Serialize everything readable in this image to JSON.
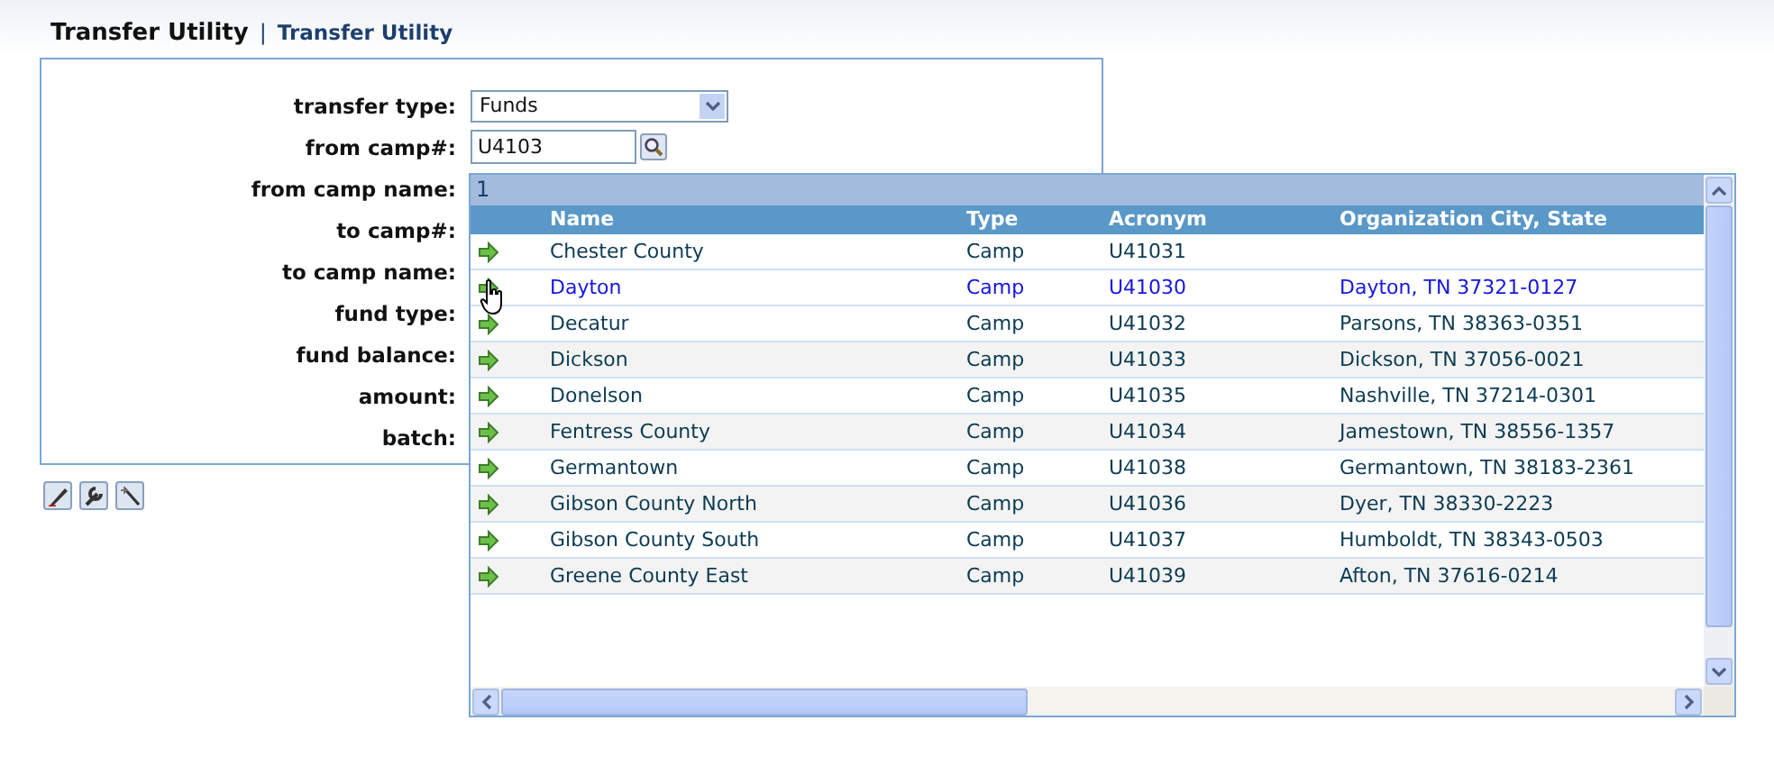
{
  "header": {
    "title": "Transfer Utility",
    "separator": "|",
    "breadcrumb": "Transfer Utility"
  },
  "form": {
    "fields": [
      {
        "label": "transfer type:",
        "kind": "select",
        "value": "Funds"
      },
      {
        "label": "from camp#:",
        "kind": "search",
        "value": "U4103"
      },
      {
        "label": "from camp name:",
        "kind": "hidden"
      },
      {
        "label": "to camp#:",
        "kind": "hidden"
      },
      {
        "label": "to camp name:",
        "kind": "hidden"
      },
      {
        "label": "fund type:",
        "kind": "hidden"
      },
      {
        "label": "fund balance:",
        "kind": "hidden"
      },
      {
        "label": "amount:",
        "kind": "hidden"
      },
      {
        "label": "batch:",
        "kind": "hidden"
      }
    ]
  },
  "lookup": {
    "page": "1",
    "columns": [
      "Name",
      "Type",
      "Acronym",
      "Organization City, State"
    ],
    "rows": [
      {
        "cells": [
          "Chester County",
          "Camp",
          "U41031",
          ""
        ],
        "hovered": false
      },
      {
        "cells": [
          "Dayton",
          "Camp",
          "U41030",
          "Dayton, TN 37321-0127"
        ],
        "hovered": true
      },
      {
        "cells": [
          "Decatur",
          "Camp",
          "U41032",
          "Parsons, TN 38363-0351"
        ],
        "hovered": false
      },
      {
        "cells": [
          "Dickson",
          "Camp",
          "U41033",
          "Dickson, TN 37056-0021"
        ],
        "hovered": false
      },
      {
        "cells": [
          "Donelson",
          "Camp",
          "U41035",
          "Nashville, TN 37214-0301"
        ],
        "hovered": false
      },
      {
        "cells": [
          "Fentress County",
          "Camp",
          "U41034",
          "Jamestown, TN 38556-1357"
        ],
        "hovered": false
      },
      {
        "cells": [
          "Germantown",
          "Camp",
          "U41038",
          "Germantown, TN 38183-2361"
        ],
        "hovered": false
      },
      {
        "cells": [
          "Gibson County North",
          "Camp",
          "U41036",
          "Dyer, TN 38330-2223"
        ],
        "hovered": false
      },
      {
        "cells": [
          "Gibson County South",
          "Camp",
          "U41037",
          "Humboldt, TN 38343-0503"
        ],
        "hovered": false
      },
      {
        "cells": [
          "Greene County East",
          "Camp",
          "U41039",
          "Afton, TN 37616-0214"
        ],
        "hovered": false
      }
    ]
  }
}
